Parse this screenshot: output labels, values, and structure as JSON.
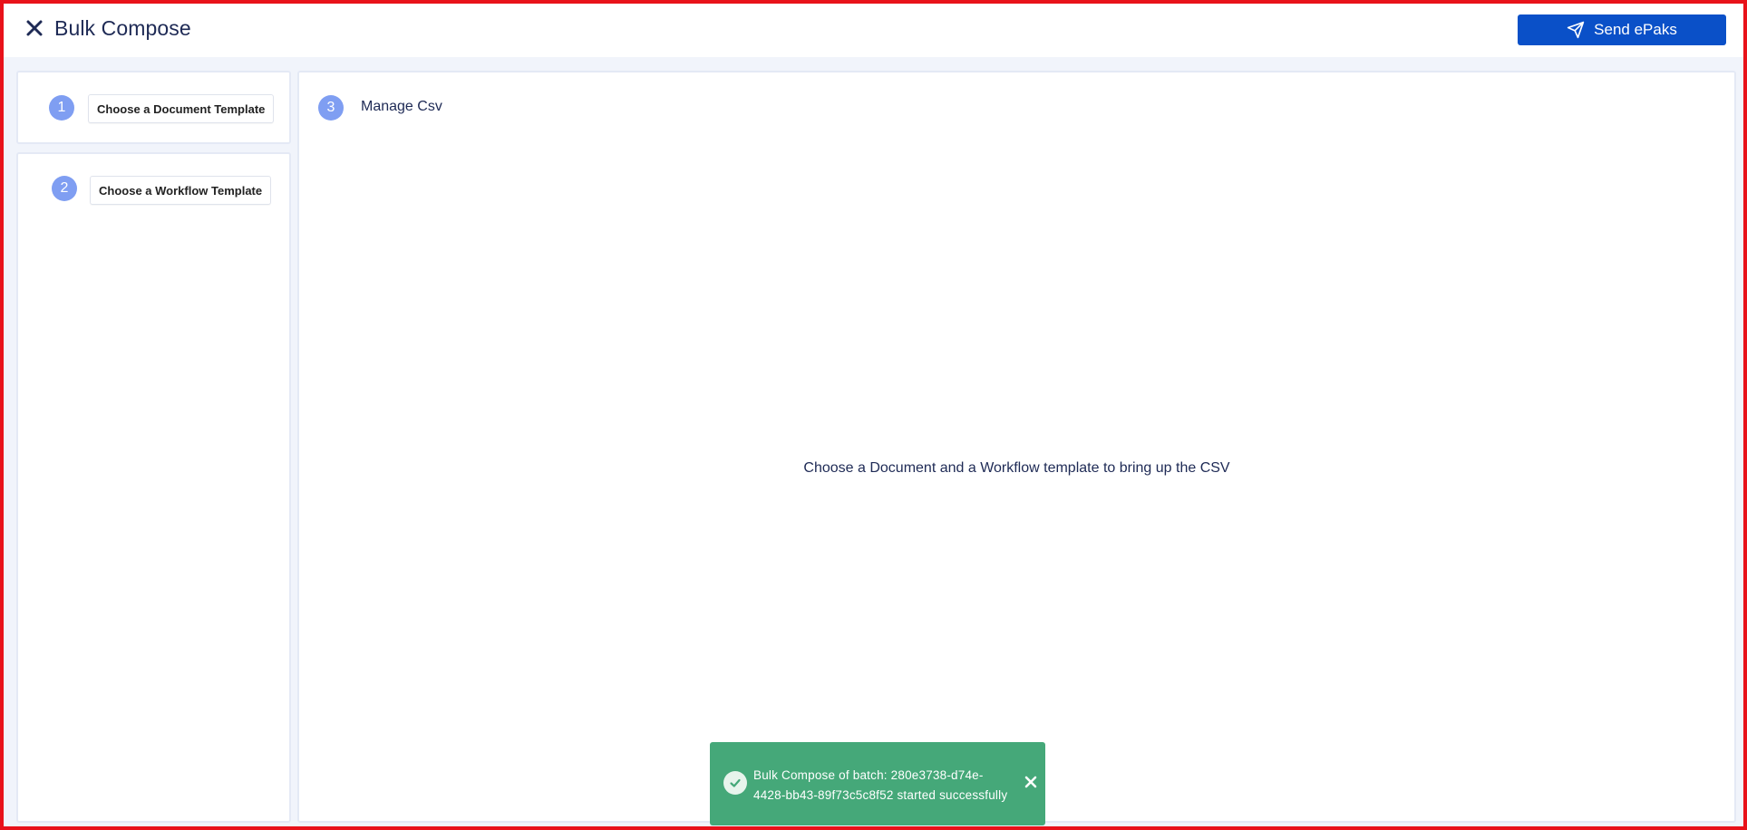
{
  "header": {
    "title": "Bulk Compose",
    "close_icon": "close-icon",
    "send_label": "Send ePaks",
    "send_icon": "paper-plane-icon"
  },
  "steps": [
    {
      "number": "1",
      "button_label": "Choose a Document Template"
    },
    {
      "number": "2",
      "button_label": "Choose a Workflow Template"
    },
    {
      "number": "3",
      "label": "Manage Csv"
    }
  ],
  "csv": {
    "empty_message": "Choose a Document and a Workflow template to bring up the CSV"
  },
  "toast": {
    "message": "Bulk Compose of batch: 280e3738-d74e-4428-bb43-89f73c5c8f52 started successfully",
    "icon": "check-circle-icon",
    "close_icon": "close-icon"
  },
  "colors": {
    "primary": "#0a50c8",
    "step_badge": "#7f9ef2",
    "toast_success": "#45a879",
    "text": "#1e2a55",
    "background": "#f1f4fb",
    "frame": "#e8121a"
  }
}
